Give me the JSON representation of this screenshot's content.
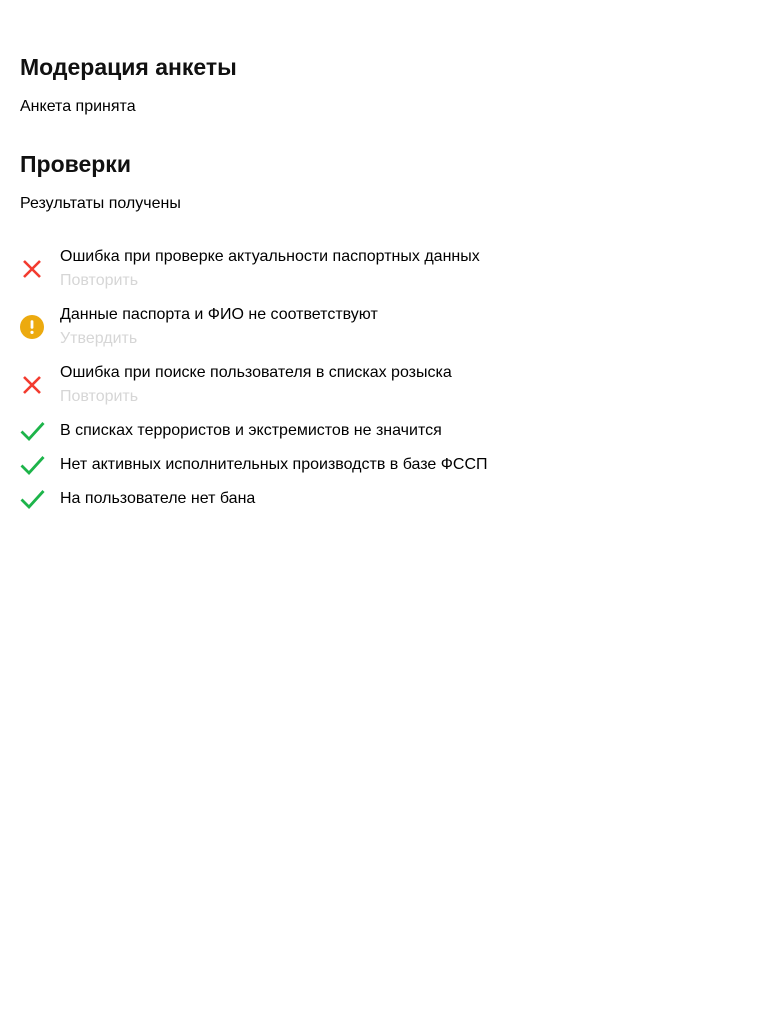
{
  "moderation": {
    "title": "Модерация анкеты",
    "status": "Анкета принята"
  },
  "checks": {
    "title": "Проверки",
    "status": "Результаты получены",
    "items": [
      {
        "icon": "error-cross-icon",
        "text": "Ошибка при проверке актуальности паспортных данных",
        "action": "Повторить"
      },
      {
        "icon": "warning-exclamation-icon",
        "text": "Данные паспорта и ФИО не соответствуют",
        "action": "Утвердить"
      },
      {
        "icon": "error-cross-icon",
        "text": "Ошибка при поиске пользователя в списках розыска",
        "action": "Повторить"
      },
      {
        "icon": "success-check-icon",
        "text": "В списках террористов и экстремистов не значится"
      },
      {
        "icon": "success-check-icon",
        "text": "Нет активных исполнительных производств в базе ФССП"
      },
      {
        "icon": "success-check-icon",
        "text": "На пользователе нет бана"
      }
    ]
  },
  "colors": {
    "error": "#f33b2f",
    "warning": "#ecaa0f",
    "success": "#1db44a",
    "action_disabled": "#d6d6d6"
  }
}
